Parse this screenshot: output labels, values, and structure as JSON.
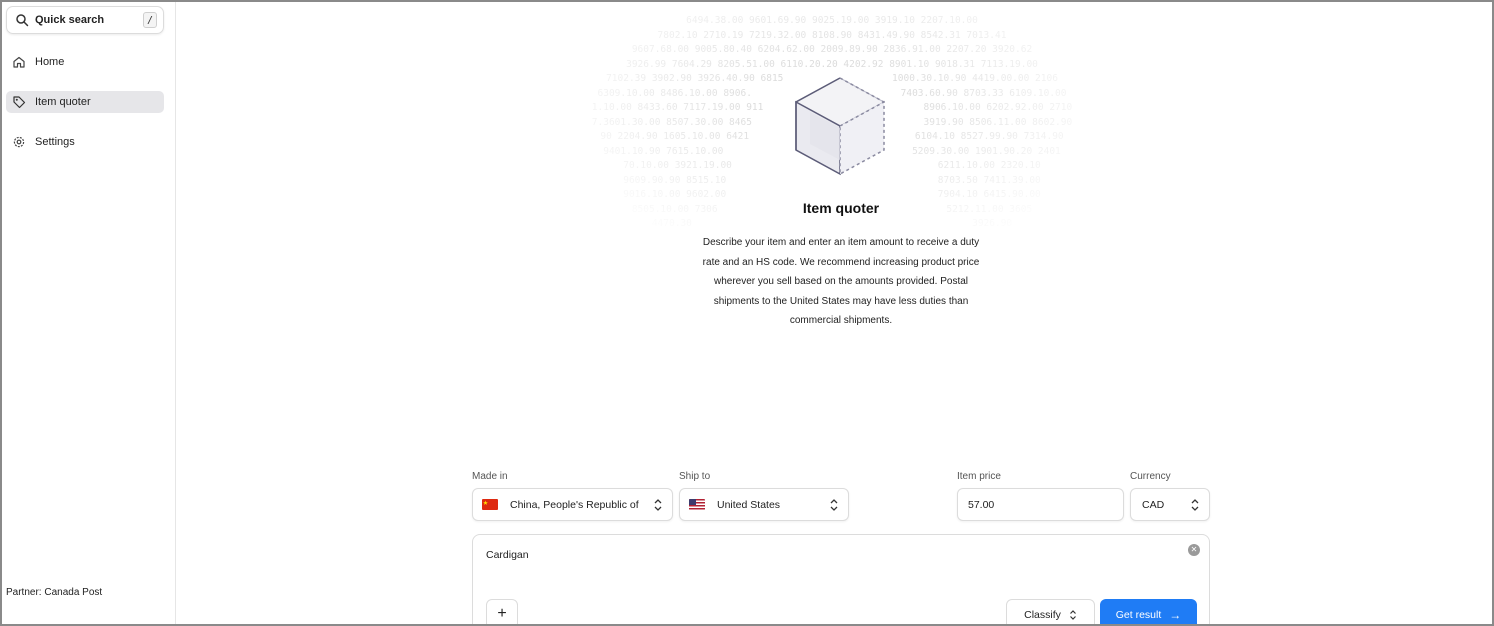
{
  "sidebar": {
    "search": {
      "label": "Quick search",
      "shortcut": "/"
    },
    "items": [
      {
        "label": "Home",
        "icon": "home-icon",
        "active": false
      },
      {
        "label": "Item quoter",
        "icon": "tag-icon",
        "active": true
      },
      {
        "label": "Settings",
        "icon": "gear-icon",
        "active": false
      }
    ],
    "partner": "Partner: Canada Post"
  },
  "hero": {
    "title": "Item quoter",
    "description": "Describe your item and enter an item amount to receive a duty rate and an HS code. We recommend increasing product price wherever you sell based on the amounts provided. Postal shipments to the United States may have less duties than commercial shipments."
  },
  "form": {
    "made_in": {
      "label": "Made in",
      "value": "China, People's Republic of",
      "flag": "china-flag-icon"
    },
    "ship_to": {
      "label": "Ship to",
      "value": "United States",
      "flag": "us-flag-icon"
    },
    "item_price": {
      "label": "Item price",
      "value": "57.00"
    },
    "currency": {
      "label": "Currency",
      "value": "CAD"
    },
    "description": {
      "value": "Cardigan"
    },
    "classify_label": "Classify",
    "submit_label": "Get result",
    "add_label": "+"
  },
  "colors": {
    "accent": "#1f7cf5",
    "active_nav": "#e6e6e9"
  }
}
